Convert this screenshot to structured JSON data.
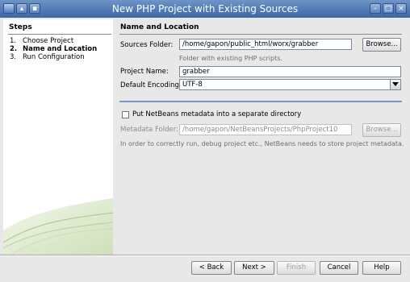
{
  "window": {
    "title": "New PHP Project with Existing Sources"
  },
  "steps": {
    "heading": "Steps",
    "items": [
      {
        "num": "1.",
        "label": "Choose Project"
      },
      {
        "num": "2.",
        "label": "Name and Location"
      },
      {
        "num": "3.",
        "label": "Run Configuration"
      }
    ]
  },
  "section": {
    "title": "Name and Location"
  },
  "form": {
    "sources_label": "Sources Folder:",
    "sources_value": "/home/gapon/public_html/worx/grabber",
    "sources_browse": "Browse...",
    "sources_hint": "Folder with existing PHP scripts.",
    "project_name_label": "Project Name:",
    "project_name_value": "grabber",
    "encoding_label": "Default Encoding:",
    "encoding_value": "UTF-8",
    "metadata_checkbox_label": "Put NetBeans metadata into a separate directory",
    "metadata_checked": false,
    "metadata_label": "Metadata Folder:",
    "metadata_value": "/home/gapon/NetBeansProjects/PhpProject10",
    "metadata_browse": "Browse...",
    "metadata_hint": "In order to correctly run, debug project etc., NetBeans needs to store project metadata."
  },
  "buttons": {
    "back": "< Back",
    "next": "Next >",
    "finish": "Finish",
    "cancel": "Cancel",
    "help": "Help"
  }
}
